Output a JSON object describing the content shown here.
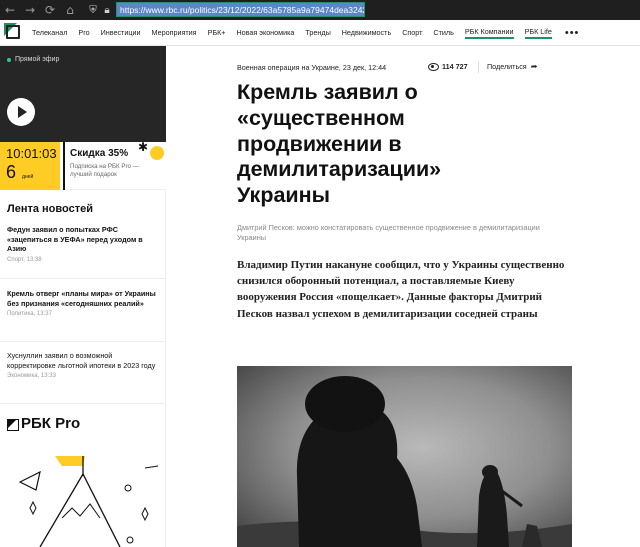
{
  "browser": {
    "back": "←",
    "forward": "→",
    "reload": "⟳",
    "home": "⌂",
    "url": "https://www.rbc.ru/politics/23/12/2022/63a5785a9a79474dea32425d"
  },
  "nav": {
    "items": [
      "Телеканал",
      "Pro",
      "Инвестиции",
      "Мероприятия",
      "РБК+",
      "Новая экономика",
      "Тренды",
      "Недвижимость",
      "Спорт",
      "Стиль",
      "РБК Компании",
      "РБК Life"
    ],
    "more": "•••"
  },
  "sidebar": {
    "live_label": "Прямой эфир",
    "promo": {
      "time": "10:01:03",
      "days": "6",
      "days_label": "дней",
      "title": "Скидка 35%",
      "subtitle": "Подписка на РБК Pro — лучший подарок"
    },
    "feed_title": "Лента новостей",
    "feed": [
      {
        "text": "Федун заявил о попытках РФС «зацепиться в УЕФА» перед уходом в Азию",
        "meta": "Спорт, 13:38"
      },
      {
        "text": "Кремль отверг «планы мира» от Украины без признания «сегодняшних реалий»",
        "meta": "Политика, 13:37"
      },
      {
        "text": "Хуснуллин заявил о возможной корректировке льготной ипотеки в 2023 году",
        "meta": "Экономика, 13:33"
      }
    ],
    "pro_logo": "РБК Pro"
  },
  "article": {
    "meta": "Военная операция на Украине, 23 дек, 12:44",
    "views": "114 727",
    "share": "Поделиться",
    "headline_lines": [
      "Кремль заявил о",
      "«существенном",
      "продвижении в",
      "демилитаризации»",
      "Украины"
    ],
    "subtitle": "Дмитрий Песков: можно констатировать существенное продвижение в демилитаризации Украины",
    "lead": "Владимир Путин накануне сообщил, что у Украины существенно снизился оборонный потенциал, а поставляемые Киеву вооружения Россия «пощелкает». Данные факторы Дмитрий Песков назвал успехом в демилитаризации соседней страны"
  }
}
